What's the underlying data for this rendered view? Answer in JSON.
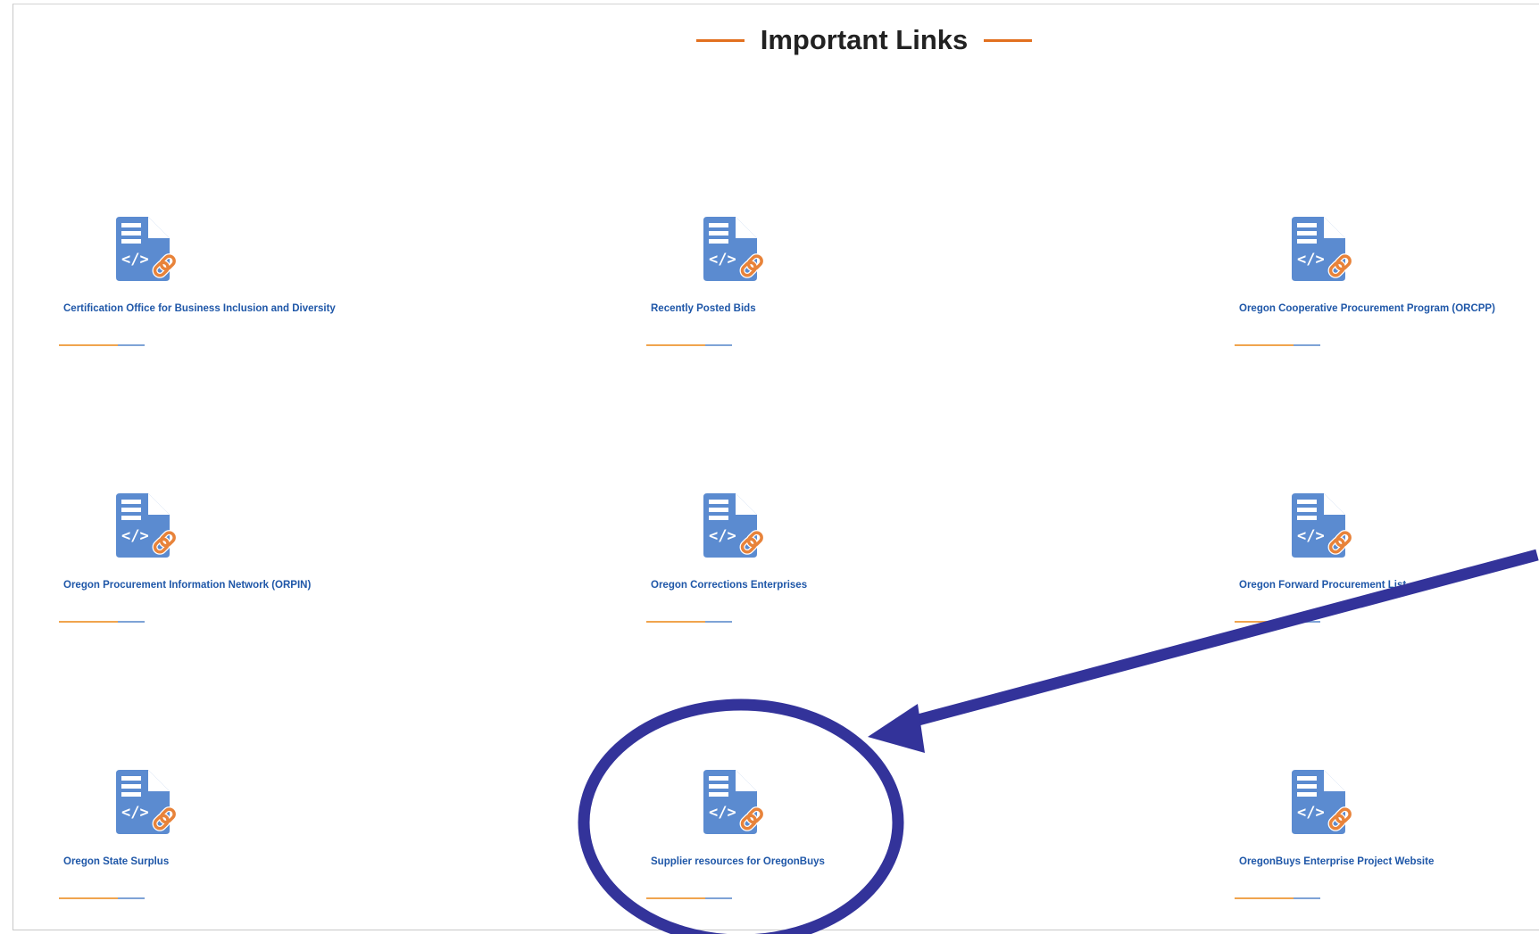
{
  "section": {
    "title": "Important Links"
  },
  "colors": {
    "accent": "#e2701f",
    "link": "#1f57a8",
    "icon": "#5b8bd0",
    "annotation": "#33339a"
  },
  "icons": {
    "link_card_icon": "document-code-link-icon"
  },
  "links": [
    {
      "label": "Certification Office for Business Inclusion and Diversity"
    },
    {
      "label": "Recently Posted Bids"
    },
    {
      "label": "Oregon Cooperative Procurement Program (ORCPP)"
    },
    {
      "label": "Oregon Procurement Information Network (ORPIN)"
    },
    {
      "label": "Oregon Corrections Enterprises"
    },
    {
      "label": "Oregon Forward Procurement List"
    },
    {
      "label": "Oregon State Surplus"
    },
    {
      "label": "Supplier resources for OregonBuys"
    },
    {
      "label": "OregonBuys Enterprise Project Website"
    }
  ],
  "annotation": {
    "type": "circle-with-arrow",
    "target": "Supplier resources for OregonBuys"
  }
}
